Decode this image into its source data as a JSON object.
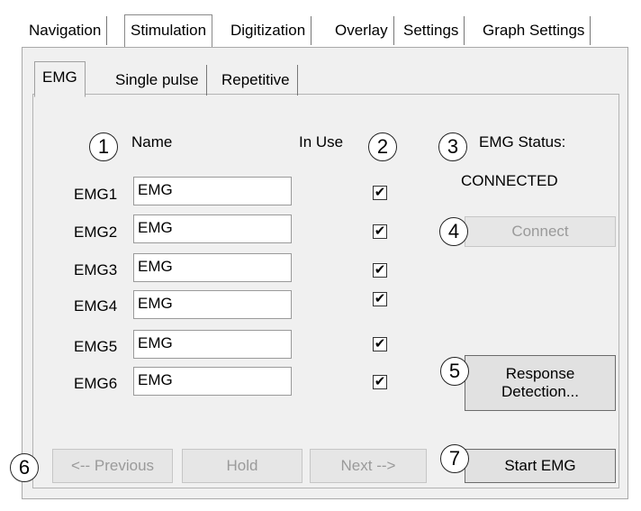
{
  "tabs": [
    {
      "label": "Navigation"
    },
    {
      "label": "Stimulation"
    },
    {
      "label": "Digitization"
    },
    {
      "label": "Overlay"
    },
    {
      "label": "Settings"
    },
    {
      "label": "Graph Settings"
    }
  ],
  "subtabs": [
    {
      "label": "EMG"
    },
    {
      "label": "Single pulse"
    },
    {
      "label": "Repetitive"
    }
  ],
  "headers": {
    "name": "Name",
    "in_use": "In Use",
    "status_label": "EMG Status:"
  },
  "status": {
    "value": "CONNECTED"
  },
  "emg_rows": [
    {
      "label": "EMG1",
      "value": "EMG",
      "in_use": true
    },
    {
      "label": "EMG2",
      "value": "EMG",
      "in_use": true
    },
    {
      "label": "EMG3",
      "value": "EMG",
      "in_use": true
    },
    {
      "label": "EMG4",
      "value": "EMG",
      "in_use": true
    },
    {
      "label": "EMG5",
      "value": "EMG",
      "in_use": true
    },
    {
      "label": "EMG6",
      "value": "EMG",
      "in_use": true
    }
  ],
  "buttons": {
    "connect": "Connect",
    "response_line1": "Response",
    "response_line2": "Detection...",
    "previous": "<-- Previous",
    "hold": "Hold",
    "next": "Next -->",
    "start": "Start EMG"
  },
  "badges": [
    "1",
    "2",
    "3",
    "4",
    "5",
    "6",
    "7"
  ],
  "check_glyph": "✔"
}
